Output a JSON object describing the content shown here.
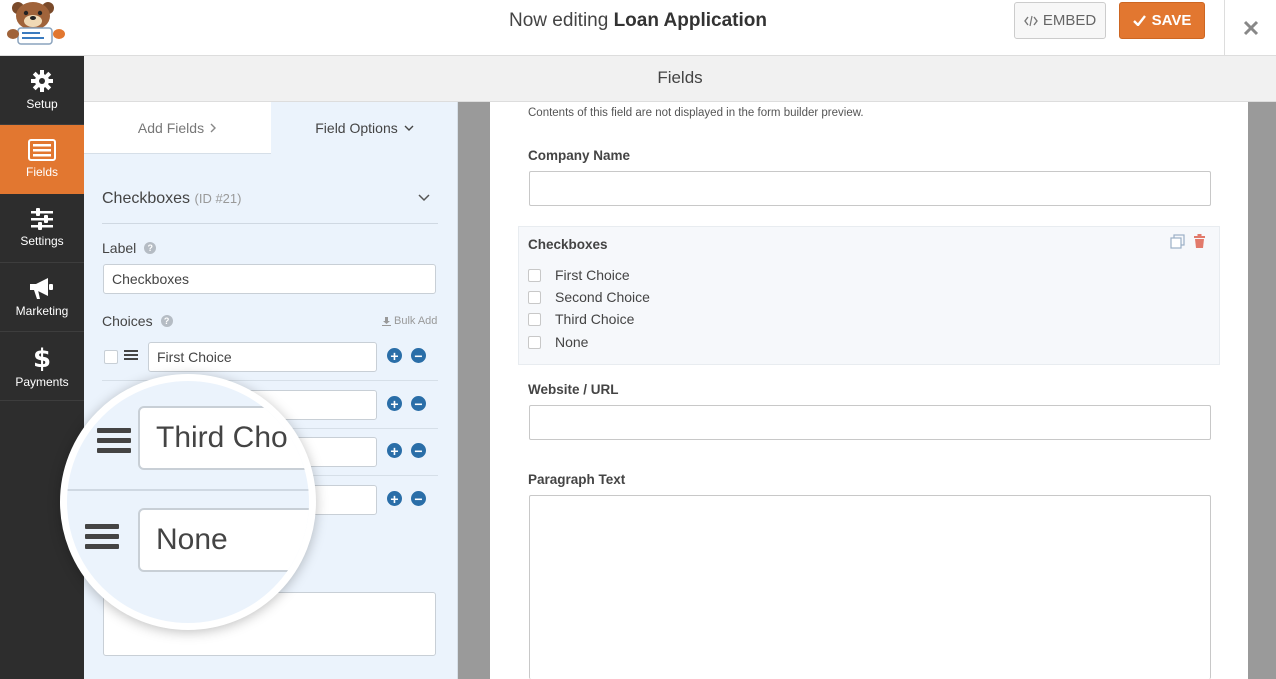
{
  "header": {
    "title_prefix": "Now editing",
    "form_name": "Loan Application",
    "embed_label": "EMBED",
    "save_label": "SAVE"
  },
  "sidebar": {
    "items": [
      {
        "label": "Setup",
        "icon": "gear-icon"
      },
      {
        "label": "Fields",
        "icon": "fields-icon",
        "active": true
      },
      {
        "label": "Settings",
        "icon": "sliders-icon"
      },
      {
        "label": "Marketing",
        "icon": "megaphone-icon"
      },
      {
        "label": "Payments",
        "icon": "dollar-icon"
      }
    ]
  },
  "subheader": {
    "title": "Fields"
  },
  "panel": {
    "tabs": {
      "add_fields": "Add Fields",
      "field_options": "Field Options"
    },
    "field_title": "Checkboxes",
    "field_id": "(ID #21)",
    "label_heading": "Label",
    "label_value": "Checkboxes",
    "choices_heading": "Choices",
    "bulk_add": "Bulk Add",
    "choices": [
      "First Choice",
      "",
      "",
      ""
    ],
    "magnified_choices": [
      "Third Cho",
      "None"
    ]
  },
  "preview": {
    "note": "Contents of this field are not displayed in the form builder preview.",
    "company_label": "Company Name",
    "checkboxes_label": "Checkboxes",
    "checkbox_choices": [
      "First Choice",
      "Second Choice",
      "Third Choice",
      "None"
    ],
    "website_label": "Website / URL",
    "paragraph_label": "Paragraph Text"
  },
  "colors": {
    "accent": "#e27730",
    "sidebar": "#2d2d2d",
    "panel": "#ebf3fc",
    "blue_button": "#2a6ea8"
  }
}
